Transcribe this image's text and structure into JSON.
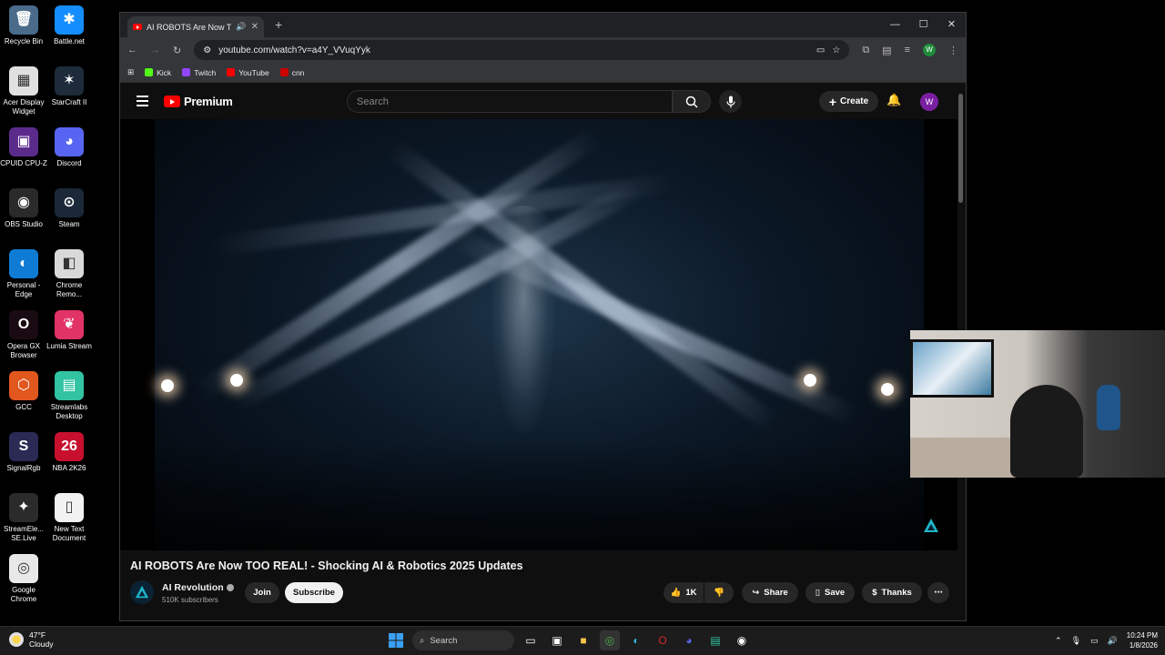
{
  "desktop": {
    "icons": [
      {
        "label": "Recycle Bin",
        "glyph": "🗑",
        "color": "#4a6b8a"
      },
      {
        "label": "Battle.net",
        "glyph": "✱",
        "color": "#148eff"
      },
      {
        "label": "Acer Display Widget",
        "glyph": "▦",
        "color": "#e0e0e0"
      },
      {
        "label": "StarCraft II",
        "glyph": "✶",
        "color": "#1d2b3a"
      },
      {
        "label": "CPUID CPU-Z",
        "glyph": "▣",
        "color": "#5b2b8c"
      },
      {
        "label": "Discord",
        "glyph": "◕",
        "color": "#5865f2"
      },
      {
        "label": "OBS Studio",
        "glyph": "◉",
        "color": "#2a2a2a"
      },
      {
        "label": "Steam",
        "glyph": "⊙",
        "color": "#1b2838"
      },
      {
        "label": "Personal - Edge",
        "glyph": "◐",
        "color": "#0f7bd4"
      },
      {
        "label": "Chrome Remo...",
        "glyph": "◧",
        "color": "#d9d9d9"
      },
      {
        "label": "Opera GX Browser",
        "glyph": "O",
        "color": "#1a0b12"
      },
      {
        "label": "Lumia Stream",
        "glyph": "❦",
        "color": "#e23366"
      },
      {
        "label": "GCC",
        "glyph": "⬡",
        "color": "#e2571e"
      },
      {
        "label": "Streamlabs Desktop",
        "glyph": "▤",
        "color": "#31c3a2"
      },
      {
        "label": "SignalRgb",
        "glyph": "S",
        "color": "#2a2a55"
      },
      {
        "label": "NBA 2K26",
        "glyph": "26",
        "color": "#c8102e"
      },
      {
        "label": "StreamEle... SE.Live",
        "glyph": "✦",
        "color": "#2b2b2b"
      },
      {
        "label": "New Text Document",
        "glyph": "▯",
        "color": "#f2f2f2"
      },
      {
        "label": "Google Chrome",
        "glyph": "◎",
        "color": "#e8e8e8"
      }
    ]
  },
  "browser": {
    "tab_title": "AI ROBOTS Are Now TOO R",
    "url": "youtube.com/watch?v=a4Y_VVuqYyk",
    "bookmarks": [
      {
        "label": "Kick",
        "color": "#53fc18"
      },
      {
        "label": "Twitch",
        "color": "#9146ff"
      },
      {
        "label": "YouTube",
        "color": "#ff0000"
      },
      {
        "label": "cnn",
        "color": "#cc0000"
      }
    ],
    "profile_initial": "W"
  },
  "youtube": {
    "logo_text": "Premium",
    "search_placeholder": "Search",
    "create_label": "Create",
    "avatar_initial": "W",
    "video_title": "AI ROBOTS Are Now TOO REAL! - Shocking AI & Robotics 2025 Updates",
    "channel_name": "AI Revolution",
    "subscribers": "510K subscribers",
    "join_label": "Join",
    "subscribe_label": "Subscribe",
    "like_count": "1K",
    "share_label": "Share",
    "save_label": "Save",
    "thanks_label": "Thanks"
  },
  "taskbar": {
    "temperature": "47°F",
    "condition": "Cloudy",
    "search_label": "Search",
    "time": "10:24 PM",
    "date": "1/8/2026"
  }
}
